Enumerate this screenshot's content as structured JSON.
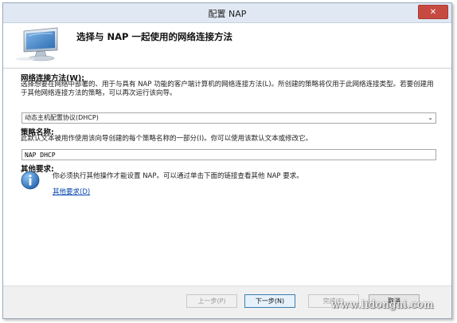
{
  "window": {
    "title": "配置 NAP",
    "close_glyph": "✕"
  },
  "header": {
    "title": "选择与 NAP 一起使用的网络连接方法",
    "icon": "monitor-network-icon"
  },
  "method_section": {
    "label": "网络连接方法(W):",
    "description": "选择想要在网络中部署的、用于与具有 NAP 功能的客户端计算机的网络连接方法(L)。所创建的策略将仅用于此网络连接类型。若要创建用于其他网络连接方法的策略，可以再次运行该向导。",
    "selected_value": "动态主机配置协议(DHCP)"
  },
  "policy_name_section": {
    "label": "策略名称:",
    "description": "此默认文本被用作使用该向导创建的每个策略名称的一部分(I)。你可以使用该默认文本或修改它。",
    "value": "NAP DHCP"
  },
  "requirements_section": {
    "label": "其他要求:",
    "info_text": "你必须执行其他操作才能设置 NAP。可以通过单击下面的链接查看其他 NAP 要求。",
    "link_text": "其他要求(D)"
  },
  "buttons": {
    "back": "上一步(P)",
    "next": "下一步(N)",
    "finish": "完成(F)",
    "cancel": "取消"
  },
  "watermark": "www.lidongni.com",
  "colors": {
    "titlebar": "#dfe8f3",
    "close": "#c74a40",
    "link": "#0645ad"
  }
}
